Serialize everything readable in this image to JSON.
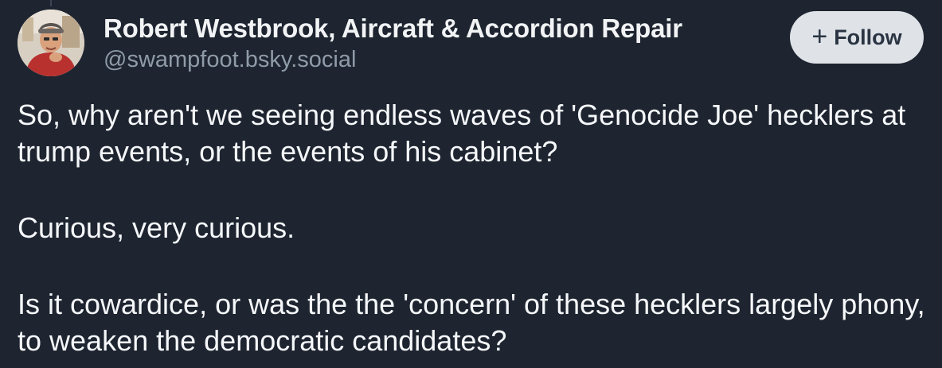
{
  "post": {
    "author": {
      "display_name": "Robert Westbrook, Aircraft & Accordion Repair",
      "handle": "@swampfoot.bsky.social"
    },
    "follow_button": {
      "icon": "plus-icon",
      "label": "Follow"
    },
    "text": {
      "paragraph_1": "So, why aren't we seeing endless waves of 'Genocide Joe' hecklers at trump events, or the events of his cabinet?",
      "paragraph_2": "Curious, very curious.",
      "paragraph_3": "Is it cowardice, or was the the 'concern' of these hecklers largely phony, to weaken the democratic candidates?"
    }
  },
  "colors": {
    "background": "#1e2530",
    "handle": "#8f9ba8",
    "follow_button_bg": "#dfe3e8",
    "follow_button_text": "#2a3442"
  }
}
